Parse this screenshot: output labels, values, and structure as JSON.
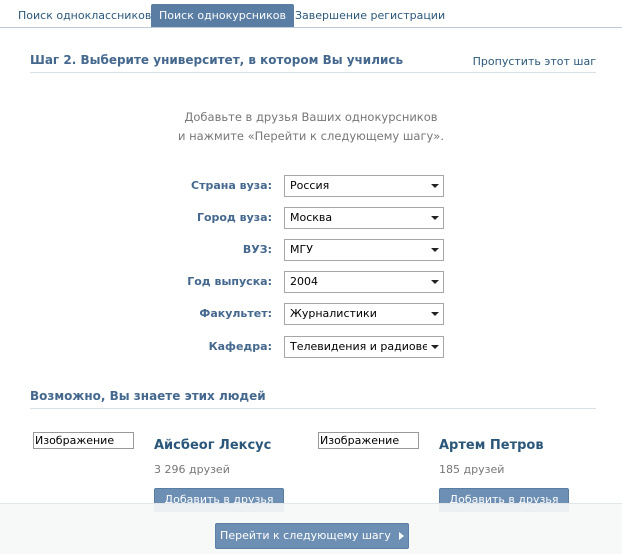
{
  "tabs": [
    {
      "label": "Поиск одноклассников",
      "active": false
    },
    {
      "label": "Поиск однокурсников",
      "active": true
    },
    {
      "label": "Завершение регистрации",
      "active": false
    }
  ],
  "step": {
    "title": "Шаг 2. Выберите университет, в котором Вы учились",
    "skip_label": "Пропустить этот шаг"
  },
  "intro": {
    "line1": "Добавьте в друзья Ваших однокурсников",
    "line2": "и нажмите «Перейти к следующему шагу»."
  },
  "form": {
    "fields": [
      {
        "label": "Страна вуза:",
        "value": "Россия"
      },
      {
        "label": "Город вуза:",
        "value": "Москва"
      },
      {
        "label": "ВУЗ:",
        "value": "МГУ"
      },
      {
        "label": "Год выпуска:",
        "value": "2004"
      },
      {
        "label": "Факультет:",
        "value": "Журналистики"
      },
      {
        "label": "Кафедра:",
        "value": "Телевидения и радиовеща"
      }
    ]
  },
  "suggestions": {
    "title": "Возможно, Вы знаете этих людей",
    "people": [
      {
        "image_alt": "Изображение",
        "name": "Айсбеог Лексус",
        "friends": "3 296 друзей",
        "add_label": "Добавить в друзья"
      },
      {
        "image_alt": "Изображение",
        "name": "Артем Петров",
        "friends": "185 друзей",
        "add_label": "Добавить в друзья"
      }
    ]
  },
  "footer": {
    "next_label": "Перейти к следующему шагу"
  },
  "colors": {
    "accent": "#597da3",
    "link": "#2b587a",
    "label": "#45688e",
    "muted": "#777777"
  }
}
